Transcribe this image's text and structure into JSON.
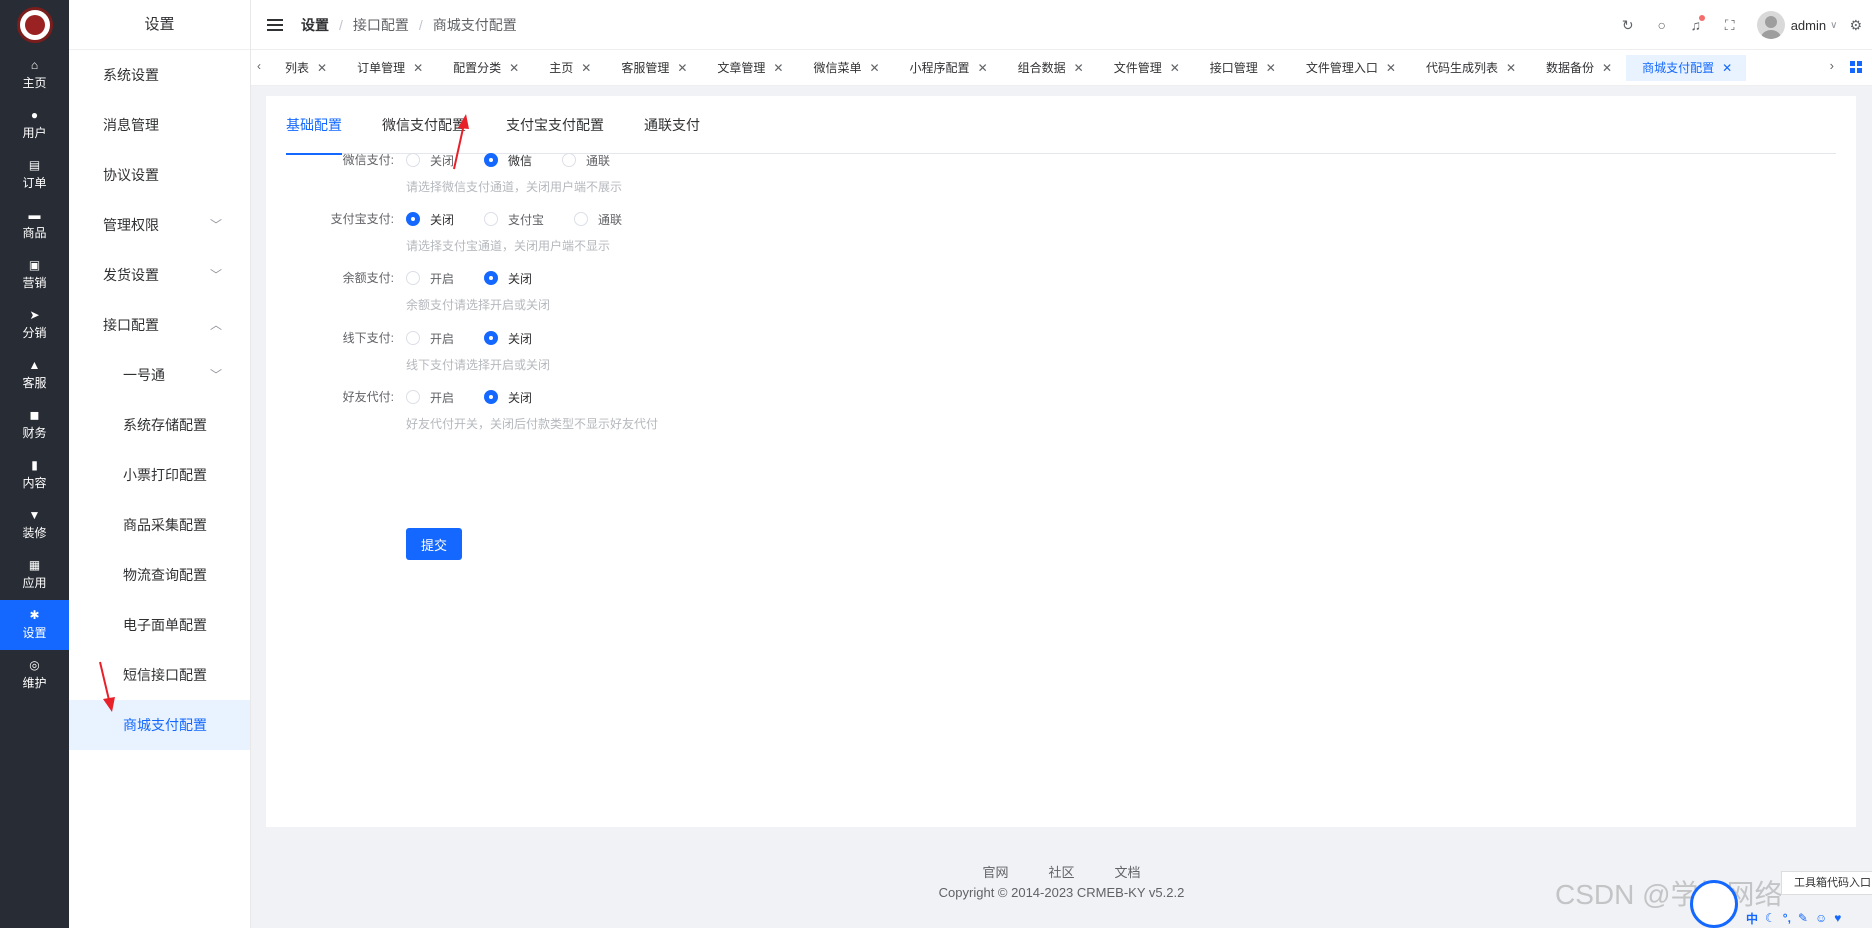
{
  "rail": {
    "items": [
      {
        "label": "主页",
        "icon": "home-icon",
        "glyph": "⌂"
      },
      {
        "label": "用户",
        "icon": "user-icon",
        "glyph": "●"
      },
      {
        "label": "订单",
        "icon": "order-icon",
        "glyph": "▤"
      },
      {
        "label": "商品",
        "icon": "product-icon",
        "glyph": "▬"
      },
      {
        "label": "营销",
        "icon": "marketing-icon",
        "glyph": "▣"
      },
      {
        "label": "分销",
        "icon": "send-icon",
        "glyph": "➤"
      },
      {
        "label": "客服",
        "icon": "bell-icon",
        "glyph": "▲"
      },
      {
        "label": "财务",
        "icon": "finance-icon",
        "glyph": "◼"
      },
      {
        "label": "内容",
        "icon": "content-icon",
        "glyph": "▮"
      },
      {
        "label": "装修",
        "icon": "brush-icon",
        "glyph": "▼"
      },
      {
        "label": "应用",
        "icon": "apps-icon",
        "glyph": "▦"
      },
      {
        "label": "设置",
        "icon": "gear-icon",
        "glyph": "✱"
      },
      {
        "label": "维护",
        "icon": "maintain-icon",
        "glyph": "◎"
      }
    ],
    "active_index": 11
  },
  "sidebar": {
    "title": "设置",
    "items": [
      {
        "label": "系统设置",
        "level": 1,
        "caret": ""
      },
      {
        "label": "消息管理",
        "level": 1,
        "caret": ""
      },
      {
        "label": "协议设置",
        "level": 1,
        "caret": ""
      },
      {
        "label": "管理权限",
        "level": 1,
        "caret": "﹀"
      },
      {
        "label": "发货设置",
        "level": 1,
        "caret": "﹀"
      },
      {
        "label": "接口配置",
        "level": 1,
        "caret": "︿"
      },
      {
        "label": "一号通",
        "level": 2,
        "caret": "﹀"
      },
      {
        "label": "系统存储配置",
        "level": 2,
        "caret": ""
      },
      {
        "label": "小票打印配置",
        "level": 2,
        "caret": ""
      },
      {
        "label": "商品采集配置",
        "level": 2,
        "caret": ""
      },
      {
        "label": "物流查询配置",
        "level": 2,
        "caret": ""
      },
      {
        "label": "电子面单配置",
        "level": 2,
        "caret": ""
      },
      {
        "label": "短信接口配置",
        "level": 2,
        "caret": ""
      },
      {
        "label": "商城支付配置",
        "level": 2,
        "caret": "",
        "active": true
      }
    ]
  },
  "header": {
    "breadcrumb": [
      "设置",
      "接口配置",
      "商城支付配置"
    ],
    "separator": "/",
    "username": "admin",
    "icons": [
      "refresh-icon",
      "search-icon",
      "bell-icon",
      "fullscreen-icon",
      "settings-icon"
    ]
  },
  "tabs": {
    "items": [
      "列表",
      "订单管理",
      "配置分类",
      "主页",
      "客服管理",
      "文章管理",
      "微信菜单",
      "小程序配置",
      "组合数据",
      "文件管理",
      "接口管理",
      "文件管理入口",
      "代码生成列表",
      "数据备份",
      "商城支付配置"
    ],
    "active_index": 14,
    "close_glyph": "✕",
    "left_glyph": "‹",
    "right_glyph": "›"
  },
  "page_tabs": {
    "items": [
      "基础配置",
      "微信支付配置",
      "支付宝支付配置",
      "通联支付"
    ],
    "active_index": 0
  },
  "form": {
    "rows": [
      {
        "label": "微信支付:",
        "options": [
          "关闭",
          "微信",
          "通联"
        ],
        "selected": 1,
        "hint": "请选择微信支付通道，关闭用户端不展示"
      },
      {
        "label": "支付宝支付:",
        "options": [
          "关闭",
          "支付宝",
          "通联"
        ],
        "selected": 0,
        "hint": "请选择支付宝通道，关闭用户端不显示"
      },
      {
        "label": "余额支付:",
        "options": [
          "开启",
          "关闭"
        ],
        "selected": 1,
        "hint": "余额支付请选择开启或关闭"
      },
      {
        "label": "线下支付:",
        "options": [
          "开启",
          "关闭"
        ],
        "selected": 1,
        "hint": "线下支付请选择开启或关闭"
      },
      {
        "label": "好友代付:",
        "options": [
          "开启",
          "关闭"
        ],
        "selected": 1,
        "hint": "好友代付开关，关闭后付款类型不显示好友代付"
      }
    ],
    "submit_label": "提交"
  },
  "footer": {
    "links": [
      "官网",
      "社区",
      "文档"
    ],
    "copyright": "Copyright © 2014-2023 CRMEB-KY v5.2.2"
  },
  "overlays": {
    "watermark": "CSDN @学枫网络",
    "float_tip": "工具箱代码入口",
    "ime_label": "中"
  },
  "colors": {
    "accent": "#1468ff",
    "rail_bg": "#282c34",
    "annotation_arrow": "#e8202a"
  }
}
